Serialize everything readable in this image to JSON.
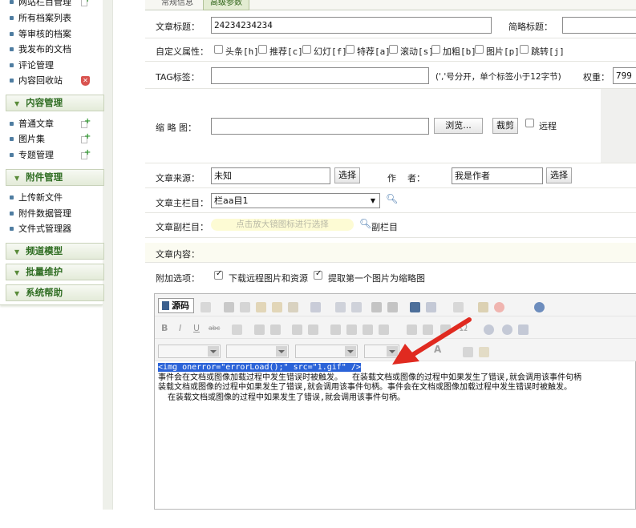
{
  "sidebar": {
    "items_top": [
      {
        "label": "网站栏目管理",
        "marker": "add"
      },
      {
        "label": "所有档案列表",
        "marker": ""
      },
      {
        "label": "等审核的档案",
        "marker": ""
      },
      {
        "label": "我发布的文档",
        "marker": ""
      },
      {
        "label": "评论管理",
        "marker": ""
      },
      {
        "label": "内容回收站",
        "marker": "delete"
      }
    ],
    "group_content": "内容管理",
    "items_content": [
      {
        "label": "普通文章",
        "marker": "add"
      },
      {
        "label": "图片集",
        "marker": "add"
      },
      {
        "label": "专题管理",
        "marker": "add"
      }
    ],
    "group_attach": "附件管理",
    "items_attach": [
      {
        "label": "上传新文件"
      },
      {
        "label": "附件数据管理"
      },
      {
        "label": "文件式管理器"
      }
    ],
    "group_channel": "频道模型",
    "group_batch": "批量维护",
    "group_help": "系统帮助"
  },
  "tabs": [
    "常规信息",
    "高级参数"
  ],
  "form": {
    "title_label": "文章标题：",
    "title_value": "24234234234",
    "short_title_label": "简略标题：",
    "flags_label": "自定义属性：",
    "flags": [
      "头条[h]",
      "推荐[c]",
      "幻灯[f]",
      "特荐[a]",
      "滚动[s]",
      "加粗[b]",
      "图片[p]",
      "跳转[j]"
    ],
    "tag_label": "TAG标签：",
    "tag_hint": "(','号分开，单个标签小于12字节)",
    "weight_label": "权重：",
    "weight_value": "799",
    "thumb_label": "缩 略 图：",
    "browse_button": "浏览...",
    "crop_button": "裁剪",
    "remote_label": "远程",
    "source_label": "文章来源：",
    "source_value": "未知",
    "select_button": "选择",
    "author_label": "作    者：",
    "author_value": "我是作者",
    "column_label": "文章主栏目：",
    "column_value": "栏aa目1",
    "subcolumn_label": "文章副栏目：",
    "subcolumn_hint": "点击放大镜图标进行选择",
    "subcolumn_link": "副栏目",
    "content_label": "文章内容：",
    "extra_label": "附加选项：",
    "extra_options": [
      "下载远程图片和资源",
      "提取第一个图片为缩略图"
    ]
  },
  "editor": {
    "source_button": "源码",
    "code_line": "<img onerror=\"errorLoad();\" src=\"1.gif\" />",
    "lines": [
      "事件会在文档或图像加载过程中发生错误时被触发。  在装载文档或图像的过程中如果发生了错误,就会调用该事件句柄",
      "装载文档或图像的过程中如果发生了错误,就会调用该事件句柄。事件会在文档或图像加载过程中发生错误时被触发。",
      "  在装载文档或图像的过程中如果发生了错误,就会调用该事件句柄。"
    ]
  },
  "colors": {
    "sidebar_group_text": "#2f6d22",
    "selection_highlight": "#2b63d8",
    "arrow": "#e02a20"
  }
}
